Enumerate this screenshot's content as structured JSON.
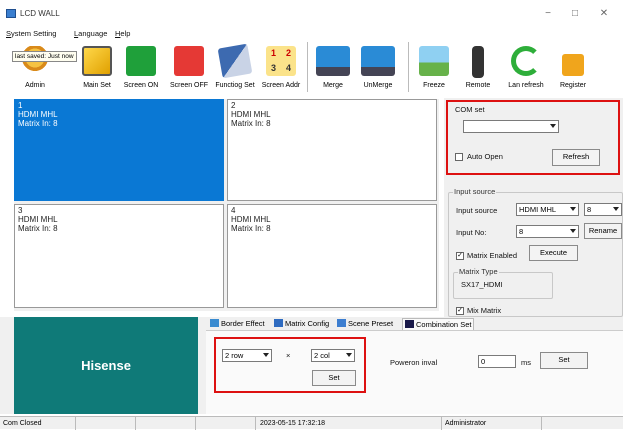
{
  "window": {
    "title": "LCD WALL",
    "min": "−",
    "max": "□",
    "close": "✕"
  },
  "menu": [
    {
      "label": "System Setting",
      "key": "S"
    },
    {
      "label": "Language",
      "key": "L"
    },
    {
      "label": "Help",
      "key": "H"
    }
  ],
  "tooltip": "last saved: Just now",
  "toolbar": [
    {
      "label": "Admin",
      "icon": "admin-icon"
    },
    {
      "label": "Main Set",
      "icon": "main-set-icon"
    },
    {
      "label": "Screen ON",
      "icon": "screen-on-icon"
    },
    {
      "label": "Screen OFF",
      "icon": "screen-off-icon"
    },
    {
      "label": "Functiog Set",
      "icon": "function-set-icon"
    },
    {
      "label": "Screen Addr",
      "icon": "screen-addr-icon",
      "digits": [
        "1",
        "2",
        "3",
        "4"
      ]
    },
    {
      "label": "Merge",
      "icon": "merge-icon"
    },
    {
      "label": "UnMerge",
      "icon": "unmerge-icon"
    },
    {
      "label": "Freeze",
      "icon": "freeze-icon"
    },
    {
      "label": "Remote",
      "icon": "remote-icon"
    },
    {
      "label": "Lan refresh",
      "icon": "lan-refresh-icon"
    },
    {
      "label": "Register",
      "icon": "register-icon"
    }
  ],
  "screens": [
    {
      "num": "1",
      "source": "HDMI MHL",
      "matrix": "Matrix In: 8"
    },
    {
      "num": "2",
      "source": "HDMI MHL",
      "matrix": "Matrix In: 8"
    },
    {
      "num": "3",
      "source": "HDMI MHL",
      "matrix": "Matrix In: 8"
    },
    {
      "num": "4",
      "source": "HDMI MHL",
      "matrix": "Matrix In: 8"
    }
  ],
  "com_set": {
    "title": "COM set",
    "port_value": "",
    "auto_open": "Auto Open",
    "refresh": "Refresh"
  },
  "input_source": {
    "title": "Input source",
    "source_label": "Input source",
    "source_value": "HDMI MHL",
    "source_num": "8",
    "input_no_label": "Input No:",
    "input_no_value": "8",
    "rename": "Rename",
    "matrix_enabled": "Matrix Enabled",
    "execute": "Execute",
    "matrix_type_title": "Matrix Type",
    "matrix_type_value": "SX17_HDMI",
    "mix_matrix": "Mix Matrix"
  },
  "tabs": [
    "Border Effect",
    "Matrix Config",
    "Scene Preset",
    "Combination Set"
  ],
  "combination": {
    "rows": "2 row",
    "x": "×",
    "cols": "2 col",
    "set": "Set",
    "poweron_label": "Poweron inval",
    "poweron_value": "0",
    "unit": "ms",
    "set2": "Set"
  },
  "logo": "Hisense",
  "status": {
    "com": "Com Closed",
    "datetime": "2023-05-15 17:32:18",
    "user": "Administrator"
  }
}
